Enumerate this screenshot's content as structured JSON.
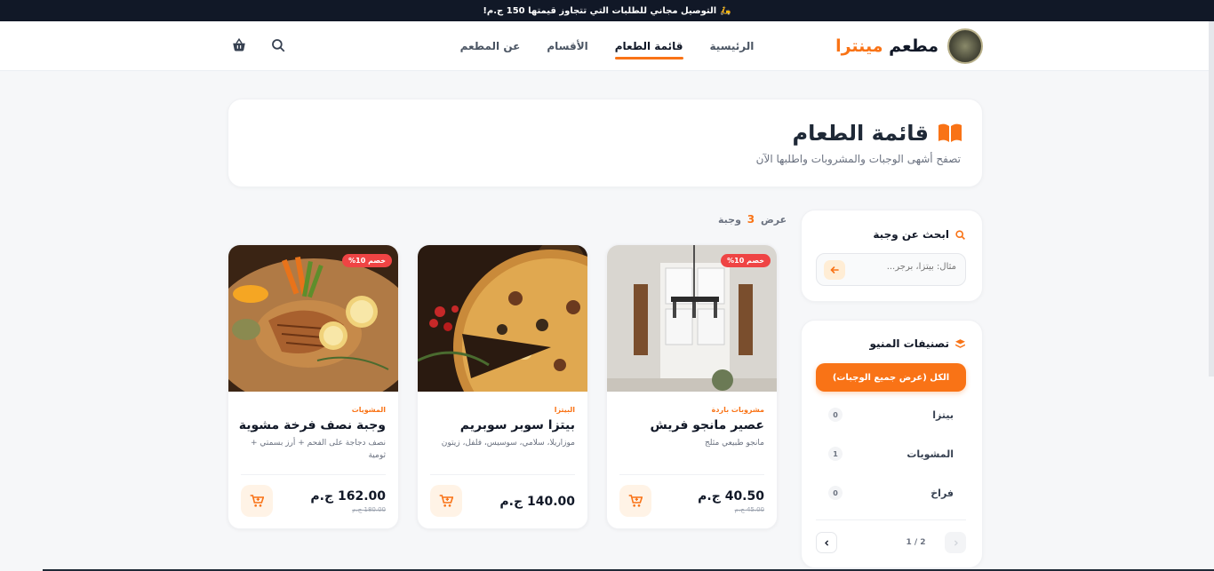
{
  "topbar": {
    "text": "التوصيل مجاني للطلبات التي تتجاوز قيمتها 150 ج.م!"
  },
  "brand": {
    "name": "مطعم",
    "accent": "مينترا"
  },
  "nav": [
    {
      "label": "الرئيسية",
      "active": false
    },
    {
      "label": "قائمة الطعام",
      "active": true
    },
    {
      "label": "الأقسام",
      "active": false
    },
    {
      "label": "عن المطعم",
      "active": false
    }
  ],
  "hero": {
    "title": "قائمة الطعام",
    "subtitle": "تصفح أشهى الوجبات والمشروبات واطلبها الآن"
  },
  "search": {
    "title": "ابحث عن وجبة",
    "placeholder": "مثال: بيتزا، برجر..."
  },
  "categories": {
    "title": "تصنيفات المنيو",
    "all_label": "الكل (عرض جميع الوجبات)",
    "items": [
      {
        "label": "بيتزا",
        "count": "0"
      },
      {
        "label": "المشويات",
        "count": "1"
      },
      {
        "label": "فراخ",
        "count": "0"
      }
    ],
    "pager": "2 / 1"
  },
  "results": {
    "prefix": "عرض",
    "count": "3",
    "suffix": "وجبة"
  },
  "cards": [
    {
      "category": "مشروبات باردة",
      "name": "عصير مانجو فريش",
      "description": "مانجو طبيعي مثلج",
      "price": "40.50 ج.م",
      "old_price": "45.00 ج.م",
      "badge": "خصم 10%"
    },
    {
      "category": "البيتزا",
      "name": "بيتزا سوبر سوبريم",
      "description": "موزاريلا، سلامي، سوسيس، فلفل، زيتون",
      "price": "140.00 ج.م",
      "old_price": "",
      "badge": ""
    },
    {
      "category": "المشويات",
      "name": "وجبة نصف فرخة مشوية",
      "description": "نصف دجاجة على الفحم + أرز بسمتي + ثومية",
      "price": "162.00 ج.م",
      "old_price": "180.00 ج.م",
      "badge": "خصم 10%"
    }
  ],
  "colors": {
    "accent": "#f97316",
    "dark": "#111827",
    "badge": "#ef4444"
  }
}
